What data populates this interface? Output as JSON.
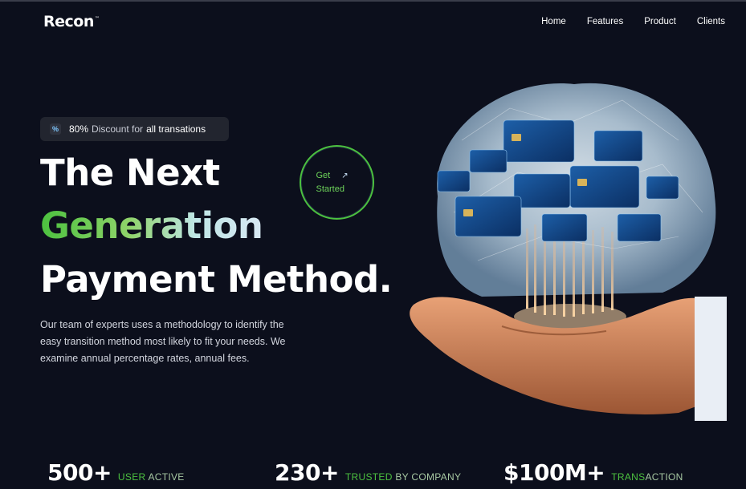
{
  "brand": {
    "name": "Recon",
    "tm": "™"
  },
  "nav": {
    "items": [
      "Home",
      "Features",
      "Product",
      "Clients"
    ]
  },
  "badge": {
    "icon": "percent-icon",
    "pct": "80%",
    "text": "Discount for",
    "highlight": "all transations"
  },
  "hero": {
    "line1": "The Next",
    "line2": "Generation",
    "line3": "Payment Method.",
    "description": "Our team of experts uses a methodology to identify the easy transition method most likely to fit your needs. We examine annual percentage rates, annual fees.",
    "cta_line1": "Get",
    "cta_line2": "Started",
    "cta_icon": "arrow-up-right-icon"
  },
  "stats": [
    {
      "number": "500+",
      "label_a": "USER",
      "label_b": " ACTIVE"
    },
    {
      "number": "230+",
      "label_a": "TRUSTED",
      "label_b": " BY COMPANY"
    },
    {
      "number": "$100M+",
      "label_a": "TRANS",
      "label_b": "ACTION"
    }
  ],
  "colors": {
    "background": "#0c0f1c",
    "accent": "#4cc13f",
    "badge_bg": "#22252f"
  }
}
